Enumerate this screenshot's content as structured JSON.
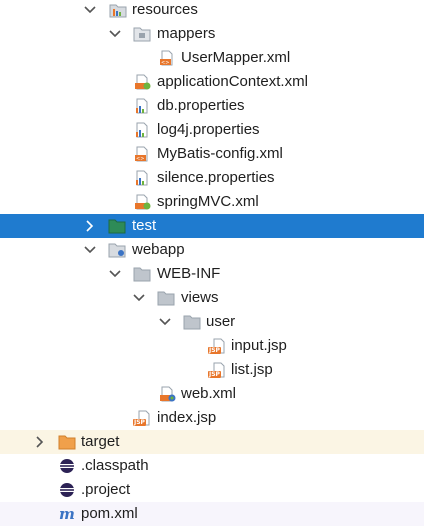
{
  "tree": {
    "resources": "resources",
    "mappers": "mappers",
    "user_mapper": "UserMapper.xml",
    "application_context": "applicationContext.xml",
    "db_properties": "db.properties",
    "log4j_properties": "log4j.properties",
    "mybatis_config": "MyBatis-config.xml",
    "silence_properties": "silence.properties",
    "spring_mvc": "springMVC.xml",
    "test": "test",
    "webapp": "webapp",
    "web_inf": "WEB-INF",
    "views": "views",
    "user": "user",
    "input_jsp": "input.jsp",
    "list_jsp": "list.jsp",
    "web_xml": "web.xml",
    "index_jsp": "index.jsp",
    "target": "target",
    "classpath": ".classpath",
    "project": ".project",
    "pom_xml": "pom.xml"
  },
  "badges": {
    "jsp": "JSP"
  },
  "colors": {
    "selection": "#1f7bcf",
    "folder": "#9aa3ad",
    "source_folder": "#2e8b57",
    "target_folder": "#f0a04b",
    "xml_orange": "#e8762b",
    "spring_green": "#6db33f",
    "maven_blue": "#3b73c4"
  }
}
